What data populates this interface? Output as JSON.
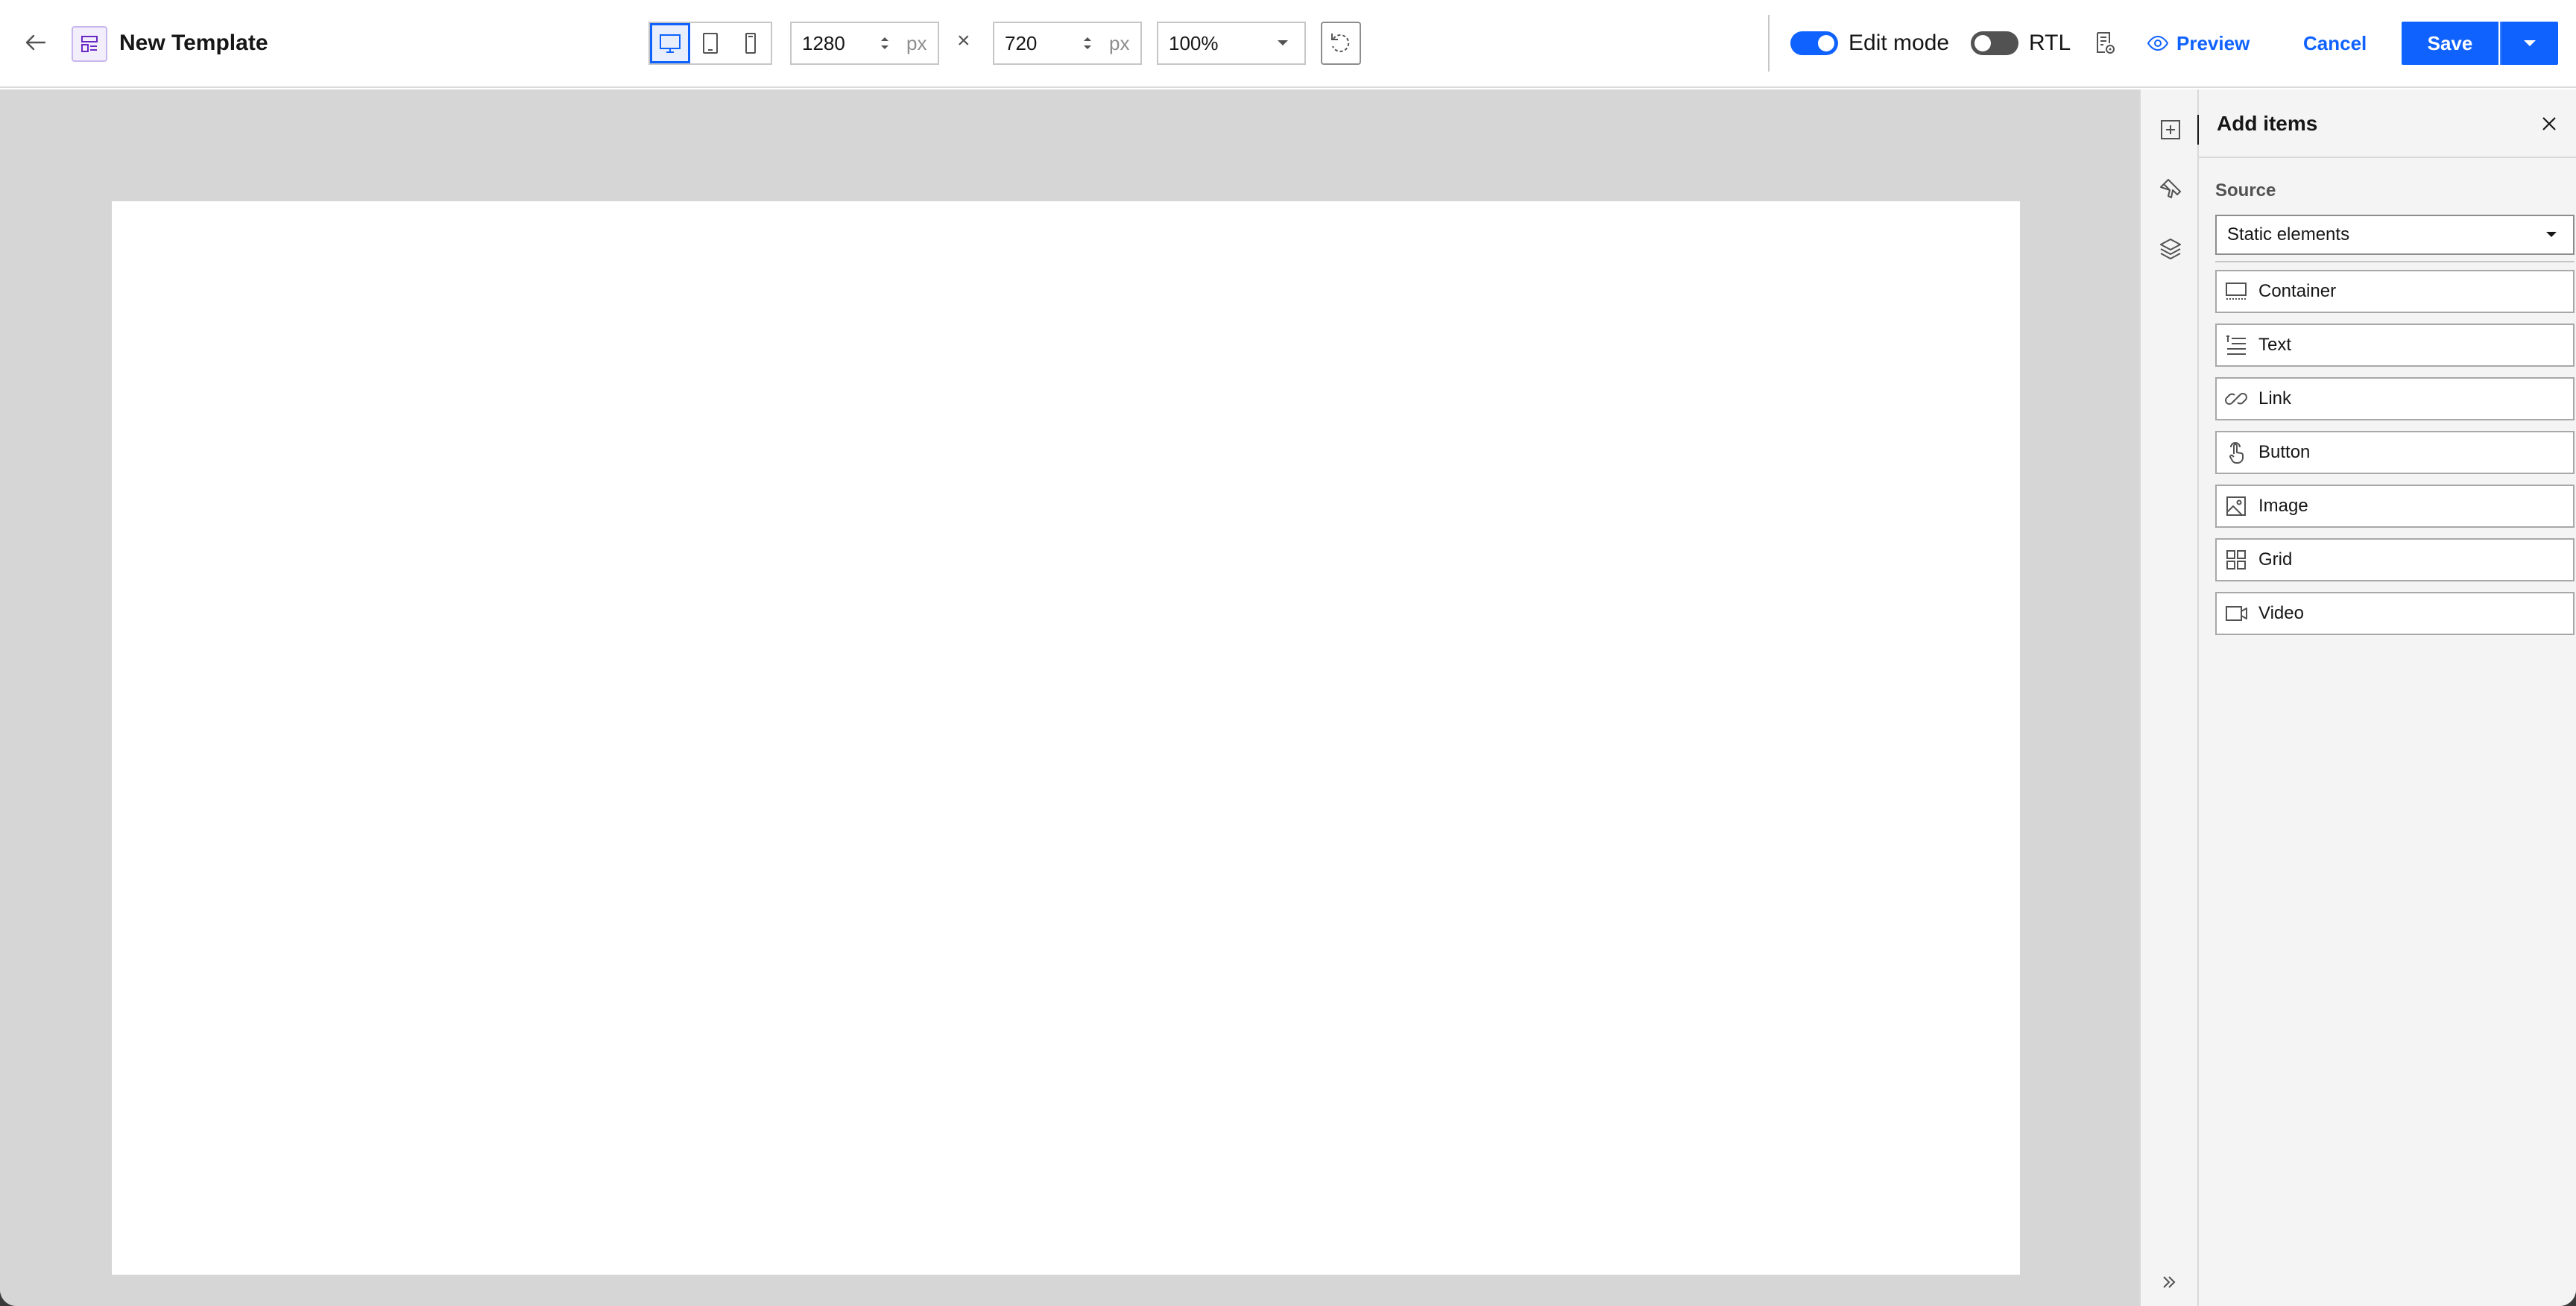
{
  "header": {
    "title": "New Template",
    "width_value": "1280",
    "height_value": "720",
    "unit": "px",
    "times_symbol": "×",
    "zoom_value": "100%",
    "edit_mode_label": "Edit mode",
    "edit_mode_on": true,
    "rtl_label": "RTL",
    "rtl_on": false,
    "preview_label": "Preview",
    "cancel_label": "Cancel",
    "save_label": "Save"
  },
  "device_modes": [
    "desktop",
    "tablet",
    "mobile"
  ],
  "selected_device": "desktop",
  "panel": {
    "title": "Add items",
    "source_label": "Source",
    "source_value": "Static elements",
    "items": [
      {
        "label": "Container",
        "icon": "container-icon"
      },
      {
        "label": "Text",
        "icon": "text-icon"
      },
      {
        "label": "Link",
        "icon": "link-icon"
      },
      {
        "label": "Button",
        "icon": "button-icon"
      },
      {
        "label": "Image",
        "icon": "image-icon"
      },
      {
        "label": "Grid",
        "icon": "grid-icon"
      },
      {
        "label": "Video",
        "icon": "video-icon"
      }
    ]
  },
  "rail": [
    "add-items-icon",
    "style-brush-icon",
    "layers-icon"
  ],
  "colors": {
    "accent": "#0f62fe",
    "canvas_background": "#d6d6d6",
    "panel_background": "#f4f4f4"
  }
}
